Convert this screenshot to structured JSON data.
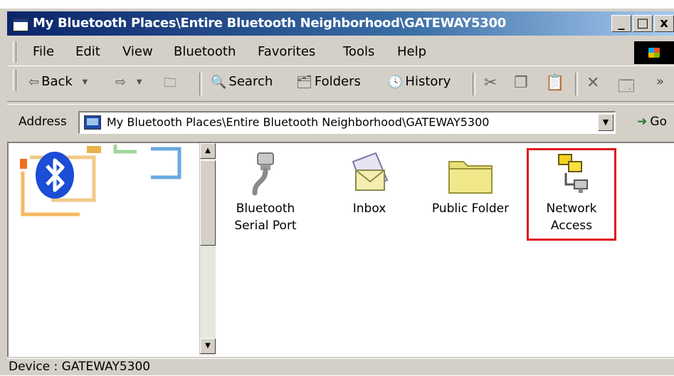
{
  "window": {
    "title": "My Bluetooth Places\\Entire Bluetooth Neighborhood\\GATEWAY5300",
    "min_glyph": "_",
    "max_glyph": "□",
    "close_glyph": "x"
  },
  "menu": {
    "items": [
      "File",
      "Edit",
      "View",
      "Bluetooth",
      "Favorites",
      "Tools",
      "Help"
    ]
  },
  "toolbar": {
    "back_label": "Back",
    "search_label": "Search",
    "folders_label": "Folders",
    "history_label": "History",
    "more_glyph": "»"
  },
  "address": {
    "label": "Address",
    "value": "My Bluetooth Places\\Entire Bluetooth Neighborhood\\GATEWAY5300",
    "go_label": "Go"
  },
  "items": [
    {
      "label_line1": "Bluetooth",
      "label_line2": "Serial Port",
      "icon": "serial-port-icon"
    },
    {
      "label_line1": "Inbox",
      "label_line2": "",
      "icon": "inbox-icon"
    },
    {
      "label_line1": "Public Folder",
      "label_line2": "",
      "icon": "folder-icon"
    },
    {
      "label_line1": "Network",
      "label_line2": "Access",
      "icon": "network-access-icon"
    }
  ],
  "highlight_color": "#e0141e",
  "status": {
    "text": "Device : GATEWAY5300"
  }
}
